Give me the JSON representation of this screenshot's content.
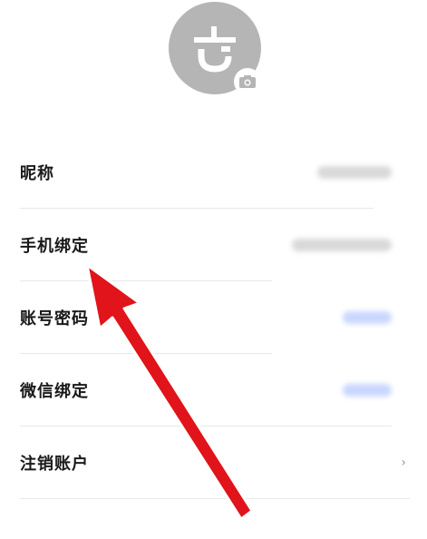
{
  "profile": {
    "avatar_icon": "brand-logo-icon",
    "camera_icon": "camera-icon"
  },
  "rows": [
    {
      "label": "昵称",
      "value_style": "gray-blur"
    },
    {
      "label": "手机绑定",
      "value_style": "gray-blur"
    },
    {
      "label": "账号密码",
      "value_style": "blue-blur"
    },
    {
      "label": "微信绑定",
      "value_style": "blue-blur"
    },
    {
      "label": "注销账户",
      "chevron": "›"
    }
  ],
  "colors": {
    "avatar_bg": "#b5b5b5",
    "text": "#1a1a1a",
    "divider": "#e8e8e8",
    "blur_gray": "#d9d9d9",
    "blur_blue": "#c9d7ff",
    "arrow_red": "#e0141a",
    "arrow_outline": "#ffffff"
  },
  "annotation": {
    "type": "arrow",
    "points_to": "手机绑定"
  }
}
